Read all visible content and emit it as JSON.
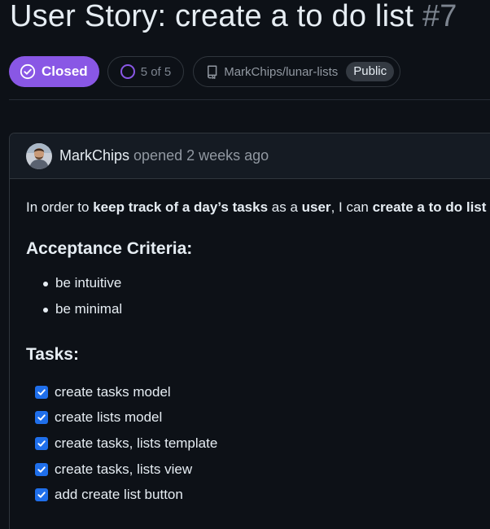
{
  "issue": {
    "title": "User Story: create a to do list",
    "number": "#7",
    "state": "Closed",
    "progress": "5 of 5",
    "repository": "MarkChips/lunar-lists",
    "visibility": "Public"
  },
  "colors": {
    "closed_badge": "#8957e5",
    "checkbox": "#1f6feb",
    "background": "#0d1117"
  },
  "comment": {
    "author": "MarkChips",
    "opened_text": "opened 2 weeks ago",
    "story": {
      "part1": "In order to ",
      "bold1": "keep track of a day’s tasks",
      "part2": " as a ",
      "bold2": "user",
      "part3": ", I can ",
      "bold3": "create a to do list"
    },
    "criteria_heading": "Acceptance Criteria:",
    "criteria": [
      "be intuitive",
      "be minimal"
    ],
    "tasks_heading": "Tasks:",
    "tasks": [
      {
        "label": "create tasks model",
        "checked": true
      },
      {
        "label": "create lists model",
        "checked": true
      },
      {
        "label": "create tasks, lists template",
        "checked": true
      },
      {
        "label": "create tasks, lists view",
        "checked": true
      },
      {
        "label": "add create list button",
        "checked": true
      }
    ]
  }
}
